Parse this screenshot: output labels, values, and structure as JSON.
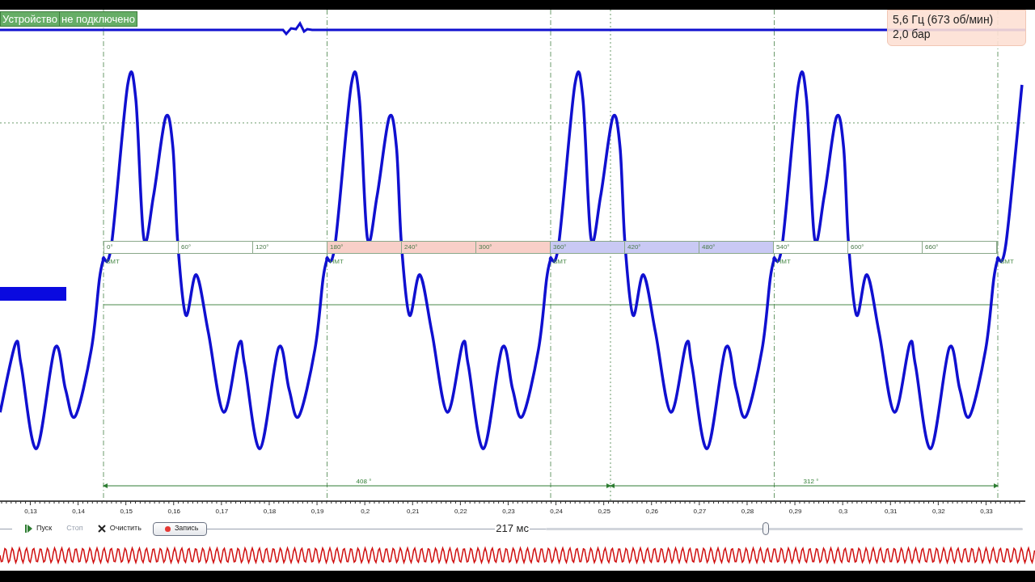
{
  "status_badge": [
    "Устройство",
    "не подключено"
  ],
  "readings": [
    "5,6 Гц (673 об/мин)",
    "2,0 бар"
  ],
  "crank_scale": {
    "segments": [
      {
        "color": "#ffffff"
      },
      {
        "color": "#f8cfc8"
      },
      {
        "color": "#c9c9f4"
      },
      {
        "color": "#ffffff"
      }
    ],
    "degrees": [
      "0°",
      "60°",
      "120°",
      "180°",
      "240°",
      "300°",
      "360°",
      "420°",
      "480°",
      "540°",
      "600°",
      "660°"
    ],
    "dead_centers": [
      "ВМТ",
      "НМТ",
      "ВМТ",
      "НМТ",
      "ВМТ"
    ]
  },
  "measurements": [
    {
      "label": "408 °"
    },
    {
      "label": "312 °"
    }
  ],
  "time_axis": {
    "ticks": [
      "0,13",
      "0,14",
      "0,15",
      "0,16",
      "0,17",
      "0,18",
      "0,19",
      "0,2",
      "0,21",
      "0,22",
      "0,23",
      "0,24",
      "0,25",
      "0,26",
      "0,27",
      "0,28",
      "0,29",
      "0,3",
      "0,31",
      "0,32",
      "0,33"
    ]
  },
  "controls": [
    {
      "label": "Пуск",
      "kind": "play",
      "disabled": false
    },
    {
      "label": "Стоп",
      "kind": "stop",
      "disabled": true
    },
    {
      "label": "Очистить",
      "kind": "clear",
      "disabled": false
    },
    {
      "label": "Запись",
      "kind": "record",
      "disabled": false
    }
  ],
  "timebase": {
    "reading": "217 мс",
    "level": 0.46
  }
}
